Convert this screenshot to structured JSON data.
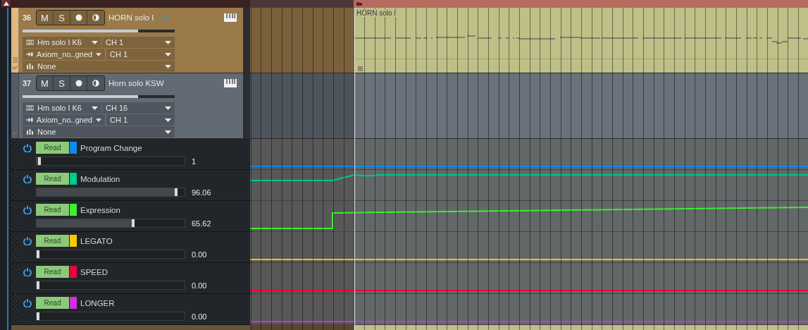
{
  "tracks": [
    {
      "number": "36",
      "name": "HORN solo I",
      "color": "#9a7a4a",
      "selected": true,
      "muted": false,
      "soloed": false,
      "mute_label": "M",
      "solo_label": "S",
      "volume": {
        "level": 0.76
      },
      "routing": [
        {
          "kind": "instrument",
          "label": "Hm solo I K6",
          "channel": "CH 1"
        },
        {
          "kind": "input",
          "label": "Axiom_no..gned",
          "channel": "CH 1"
        },
        {
          "kind": "insert",
          "label": "None"
        }
      ],
      "region": {
        "name": "HORN solo I"
      }
    },
    {
      "number": "37",
      "name": "Horn solo KSW",
      "color": "#626a74",
      "selected": false,
      "muted": false,
      "soloed": false,
      "mute_label": "M",
      "solo_label": "S",
      "volume": {
        "level": 0.76
      },
      "routing": [
        {
          "kind": "instrument",
          "label": "Hm solo I K6",
          "channel": "CH 16"
        },
        {
          "kind": "input",
          "label": "Axiom_no..gned",
          "channel": "CH 1"
        },
        {
          "kind": "insert",
          "label": "None"
        }
      ]
    }
  ],
  "automation_lanes": [
    {
      "name": "Program Change",
      "mode": "Read",
      "color": "#0a8cf0",
      "level": 0.01,
      "reading": "1",
      "kind": "flat"
    },
    {
      "name": "Modulation",
      "mode": "Read",
      "color": "#00c890",
      "level": 0.96,
      "reading": "96.06",
      "kind": "ramp"
    },
    {
      "name": "Expression",
      "mode": "Read",
      "color": "#40f030",
      "level": 0.66,
      "reading": "65.62",
      "kind": "step"
    },
    {
      "name": "LEGATO",
      "mode": "Read",
      "color": "#f8c800",
      "level": 0,
      "reading": "0.00",
      "kind": "flat"
    },
    {
      "name": "SPEED",
      "mode": "Read",
      "color": "#f00040",
      "level": 0,
      "reading": "0.00",
      "kind": "flat"
    },
    {
      "name": "LONGER",
      "mode": "Read",
      "color": "#d030e0",
      "level": 0,
      "reading": "0.00",
      "kind": "flat"
    }
  ]
}
